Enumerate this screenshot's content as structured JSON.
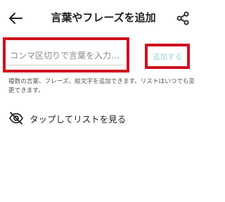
{
  "header": {
    "title": "言葉やフレーズを追加"
  },
  "input": {
    "placeholder": "コンマ区切りで言葉を入力...",
    "value": ""
  },
  "add_button": {
    "label": "追加する"
  },
  "help_text": "複数の言葉、フレーズ、絵文字を追加できます。リストはいつでも変更できます。",
  "list_link": {
    "label": "タップしてリストを見る"
  },
  "colors": {
    "highlight_border": "#d0111e",
    "add_button_disabled": "#9fd3d6"
  }
}
